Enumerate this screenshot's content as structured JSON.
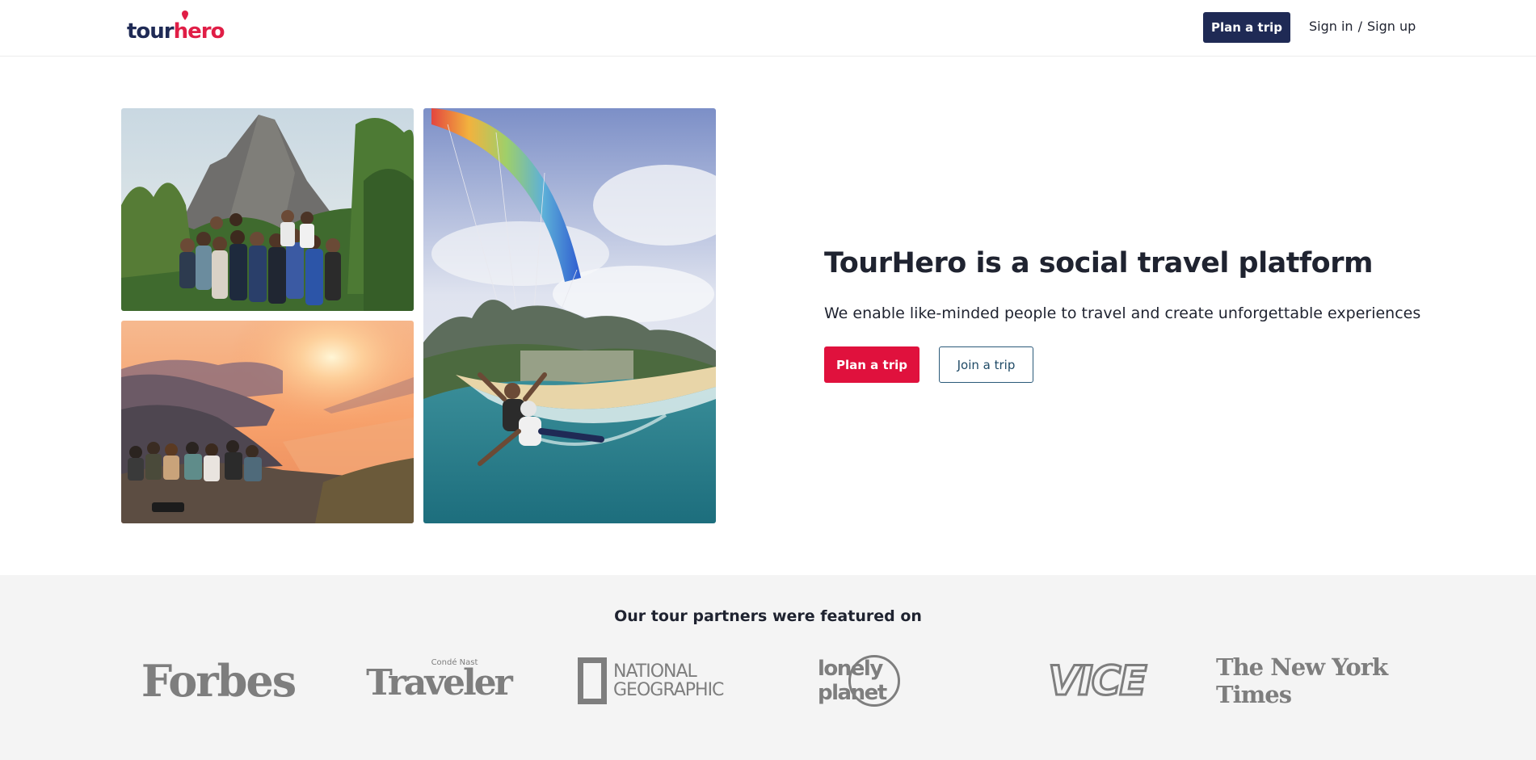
{
  "header": {
    "logo_part1": "tour",
    "logo_part2": "hero",
    "plan_trip_label": "Plan a trip",
    "sign_in_label": "Sign in",
    "separator": "/",
    "sign_up_label": "Sign up"
  },
  "hero": {
    "title": "TourHero is a social travel platform",
    "subtitle": "We enable like-minded people to travel and create unforgettable experiences",
    "plan_trip_label": "Plan a trip",
    "join_trip_label": "Join a trip"
  },
  "featured": {
    "title": "Our tour partners were featured on",
    "logos": {
      "forbes": "Forbes",
      "traveler_small": "Condé Nast",
      "traveler_big": "Traveler",
      "natgeo_line1": "NATIONAL",
      "natgeo_line2": "GEOGRAPHIC",
      "lonely_planet": "lonely planet",
      "vice": "VICE",
      "nyt": "The New York Times"
    }
  },
  "colors": {
    "brand_navy": "#1f2a55",
    "brand_red": "#e0113d",
    "band_gray": "#f4f4f4",
    "logo_gray": "#7e7e7e"
  }
}
